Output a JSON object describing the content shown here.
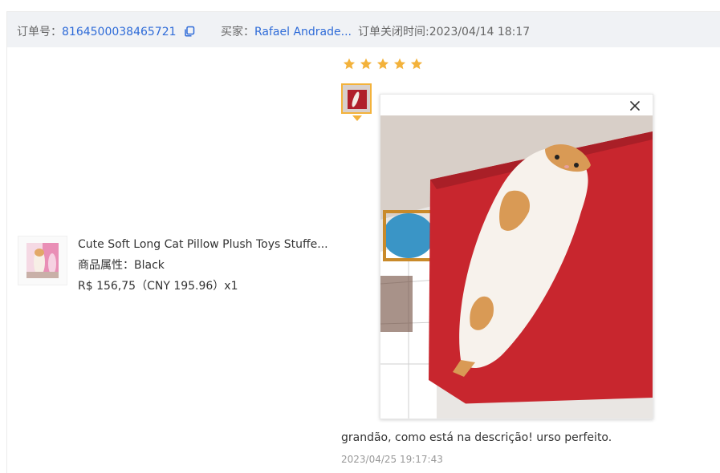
{
  "header": {
    "order_label": "订单号：",
    "order_number": "8164500038465721",
    "buyer_label": "买家：",
    "buyer_name": "Rafael Andrade...",
    "close_time": "订单关闭时间:2023/04/14 18:17"
  },
  "product": {
    "title": "Cute Soft Long Cat Pillow Plush Toys Stuffe...",
    "attribute_label": "商品属性：",
    "attribute_value": "Black",
    "price_line": "R$ 156,75（CNY  195.96）x1"
  },
  "review": {
    "rating": 5,
    "text": "grandão, como está na descrição! urso perfeito.",
    "date": "2023/04/25 19:17:43"
  },
  "icons": {
    "copy": "copy-icon",
    "close": "close-icon",
    "star": "star-icon"
  },
  "colors": {
    "link": "#2e6bd8",
    "star": "#f3b23b",
    "header_bg": "#f0f2f5"
  }
}
